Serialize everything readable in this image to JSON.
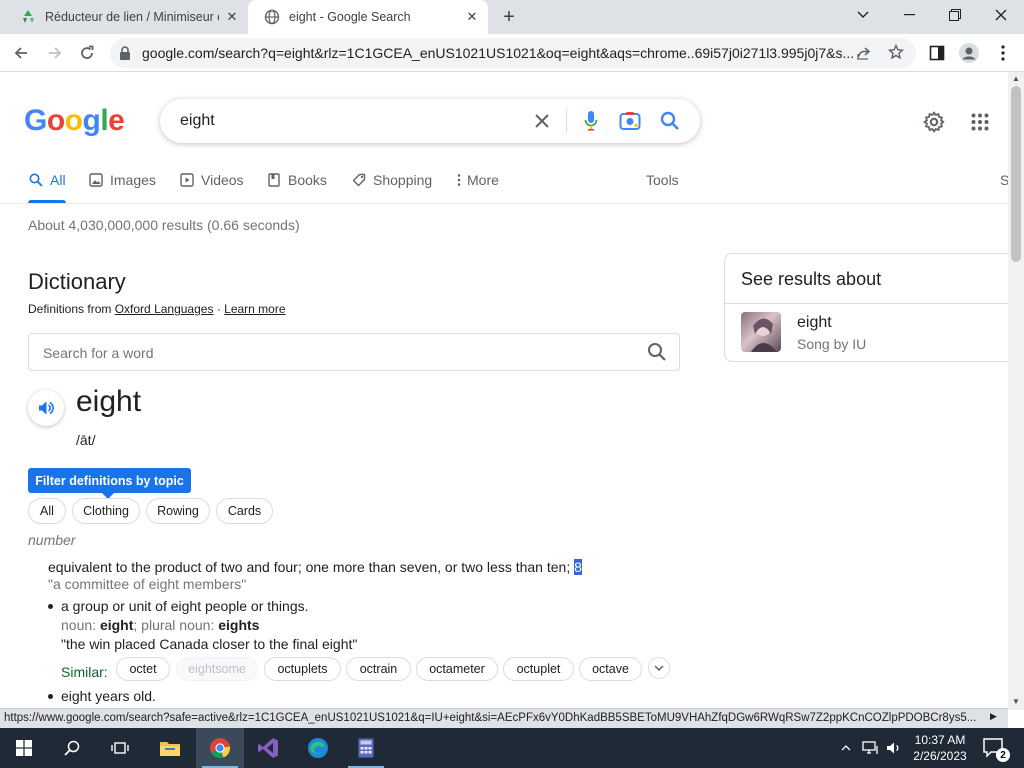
{
  "browser": {
    "tabs": [
      {
        "title": "Réducteur de lien / Minimiseur d",
        "active": false
      },
      {
        "title": "eight - Google Search",
        "active": true
      }
    ],
    "url": "google.com/search?q=eight&rlz=1C1GCEA_enUS1021US1021&oq=eight&aqs=chrome..69i57j0i271l3.995j0j7&s...",
    "status_url": "https://www.google.com/search?safe=active&rlz=1C1GCEA_enUS1021US1021&q=IU+eight&si=AEcPFx6vY0DhKadBB5SBEToMU9VHAhZfqDGw6RWqRSw7Z2ppKCnCOZlpPDOBCr8ys5..."
  },
  "google": {
    "logo_letters": [
      {
        "ch": "G",
        "color": "#4285f4"
      },
      {
        "ch": "o",
        "color": "#ea4335"
      },
      {
        "ch": "o",
        "color": "#fbbc05"
      },
      {
        "ch": "g",
        "color": "#4285f4"
      },
      {
        "ch": "l",
        "color": "#34a853"
      },
      {
        "ch": "e",
        "color": "#ea4335"
      }
    ],
    "query": "eight",
    "nav": {
      "all": "All",
      "images": "Images",
      "videos": "Videos",
      "books": "Books",
      "shopping": "Shopping",
      "more": "More",
      "tools": "Tools",
      "clipped": "S"
    },
    "stats": "About 4,030,000,000 results (0.66 seconds)"
  },
  "dictionary": {
    "title": "Dictionary",
    "source_prefix": "Definitions from",
    "source_link": "Oxford Languages",
    "separator": "·",
    "learn_more": "Learn more",
    "search_placeholder": "Search for a word",
    "headword": "eight",
    "phonetic": "/āt/",
    "filter_label": "Filter definitions by topic",
    "topics": [
      "All",
      "Clothing",
      "Rowing",
      "Cards"
    ],
    "part_of_speech": "number",
    "definition_1": "equivalent to the product of two and four; one more than seven, or two less than ten;",
    "definition_1_highlight": "8",
    "example_1": "\"a committee of eight members\"",
    "definition_2": "a group or unit of eight people or things.",
    "noun_prefix": "noun:",
    "noun_word": "eight",
    "plural_prefix": "; plural noun:",
    "plural_word": "eights",
    "example_2": "\"the win placed Canada closer to the final eight\"",
    "similar_label": "Similar:",
    "similar": [
      "octet",
      "eightsome",
      "octuplets",
      "octrain",
      "octameter",
      "octuplet",
      "octave"
    ],
    "definition_3": "eight years old."
  },
  "knowledge_panel": {
    "title": "See results about",
    "name": "eight",
    "subtitle": "Song by IU"
  },
  "taskbar": {
    "time": "10:37 AM",
    "date": "2/26/2023",
    "notification_count": "2"
  }
}
